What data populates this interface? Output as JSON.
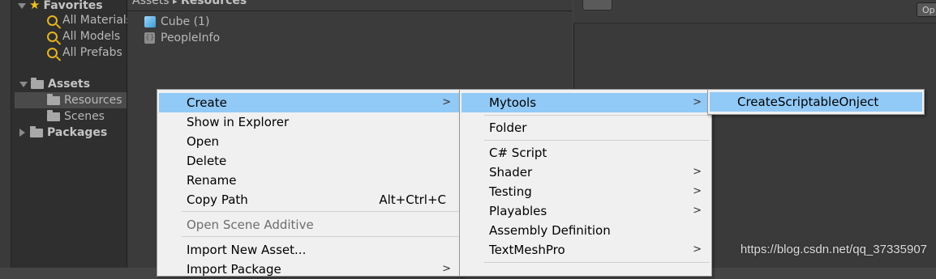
{
  "favorites": {
    "label": "Favorites",
    "items": [
      "All Materials",
      "All Models",
      "All Prefabs"
    ]
  },
  "tree": {
    "assets_label": "Assets",
    "resources_label": "Resources",
    "scenes_label": "Scenes",
    "packages_label": "Packages"
  },
  "breadcrumb": {
    "root": "Assets",
    "sep": "▸",
    "current": "Resources"
  },
  "asset_items": [
    "Cube (1)",
    "PeopleInfo"
  ],
  "inspector": {
    "open_label": "Op"
  },
  "context_menu": {
    "items": [
      {
        "label": "Create",
        "shortcut": "",
        "submenu": true,
        "highlighted": true
      },
      {
        "label": "Show in Explorer",
        "shortcut": ""
      },
      {
        "label": "Open",
        "shortcut": ""
      },
      {
        "label": "Delete",
        "shortcut": ""
      },
      {
        "label": "Rename",
        "shortcut": ""
      },
      {
        "label": "Copy Path",
        "shortcut": "Alt+Ctrl+C"
      },
      {
        "label": "Open Scene Additive",
        "shortcut": "",
        "disabled": true
      },
      {
        "label": "Import New Asset...",
        "shortcut": ""
      },
      {
        "label": "Import Package",
        "shortcut": "",
        "submenu": true
      }
    ]
  },
  "create_menu": {
    "items": [
      {
        "label": "Mytools",
        "submenu": true,
        "highlighted": true
      },
      {
        "label": "Folder"
      },
      {
        "label": "C# Script"
      },
      {
        "label": "Shader",
        "submenu": true
      },
      {
        "label": "Testing",
        "submenu": true
      },
      {
        "label": "Playables",
        "submenu": true
      },
      {
        "label": "Assembly Definition"
      },
      {
        "label": "TextMeshPro",
        "submenu": true
      }
    ]
  },
  "mytools_menu": {
    "items": [
      {
        "label": "CreateScriptableOnject",
        "highlighted": true
      }
    ]
  },
  "submenu_arrow": ">",
  "watermark": "https://blog.csdn.net/qq_37335907",
  "colors": {
    "highlight": "#91c9f7",
    "menu_bg": "#f0f0f0",
    "panel_dark": "#2f2f2f"
  }
}
